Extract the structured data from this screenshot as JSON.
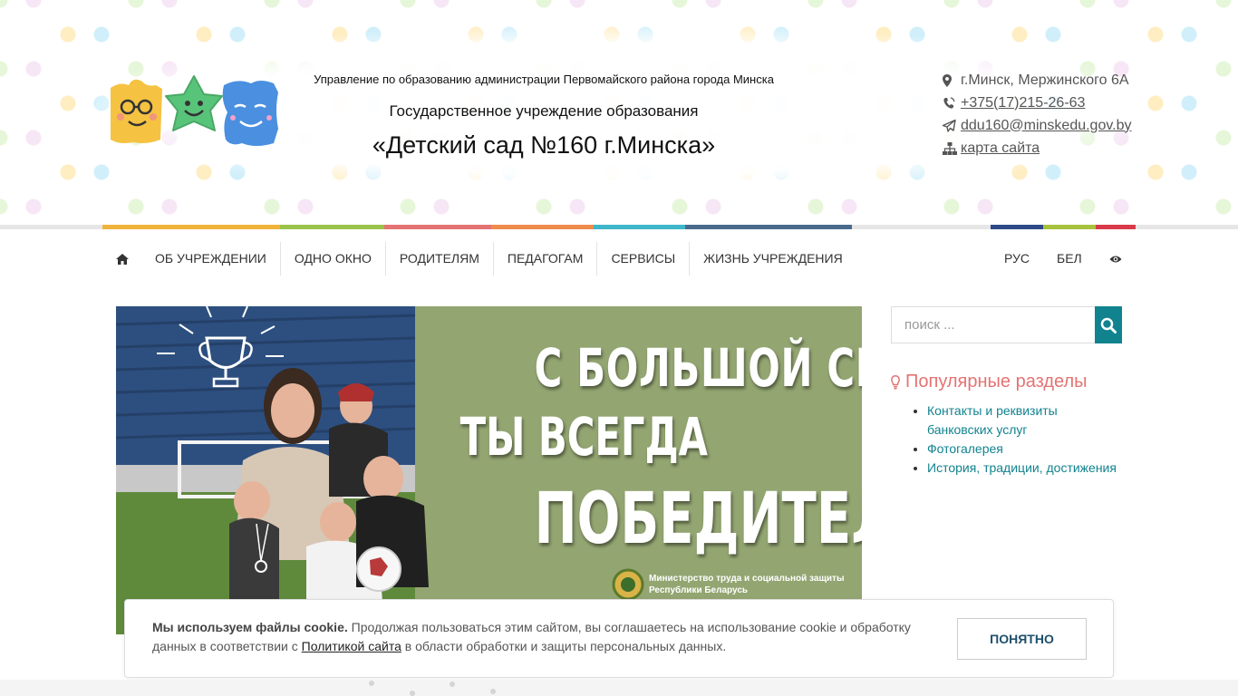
{
  "header": {
    "parent_org": "Управление по образованию администрации Первомайского района города Минска",
    "org_type": "Государственное учреждение образования",
    "org_name": "«Детский сад №160 г.Минска»",
    "contacts": {
      "address": "г.Минск, Мержинского 6А",
      "phone": "+375(17)215-26-63",
      "email": "ddu160@minskedu.gov.by",
      "sitemap": "карта сайта"
    }
  },
  "nav": {
    "items": [
      {
        "label": "ОБ УЧРЕЖДЕНИИ"
      },
      {
        "label": "ОДНО ОКНО"
      },
      {
        "label": "РОДИТЕЛЯМ"
      },
      {
        "label": "ПЕДАГОГАМ"
      },
      {
        "label": "СЕРВИСЫ"
      },
      {
        "label": "ЖИЗНЬ УЧРЕЖДЕНИЯ"
      }
    ],
    "lang_ru": "РУС",
    "lang_by": "БЕЛ"
  },
  "banner": {
    "line1": "С БОЛЬШОЙ СЕМЬЁЙ",
    "line2": "ТЫ ВСЕГДА",
    "line3": "ПОБЕДИТЕЛЬ",
    "ministry_line1": "Министерство труда и социальной защиты",
    "ministry_line2": "Республики Беларусь"
  },
  "sidebar": {
    "search_placeholder": "поиск ...",
    "popular_title": "Популярные разделы",
    "popular_items": [
      "Контакты и реквизиты банковских услуг",
      "Фотогалерея",
      "История, традиции, достижения"
    ]
  },
  "cookie": {
    "bold": "Мы используем файлы cookie.",
    "text_before_link": " Продолжая пользоваться этим сайтом, вы соглашаетесь на использование cookie и обработку данных в соответствии с ",
    "link": "Политикой сайта",
    "text_after_link": " в области обработки и защиты персональных данных.",
    "button": "ПОНЯТНО"
  },
  "colors": {
    "accent_teal": "#11838f",
    "popular_title": "#e57373",
    "strip": [
      "#f0b43a",
      "#9bc34a",
      "#e57373",
      "#ef8c4c",
      "#3fb6c9",
      "#4a6a8c",
      "#2e4a86",
      "#a7c23d",
      "#d83a4a"
    ]
  },
  "icons": {
    "home": "home-icon",
    "eye": "eye-icon",
    "search": "search-icon",
    "lightbulb": "lightbulb-icon",
    "map_marker": "map-marker-icon",
    "phone": "phone-icon",
    "send": "paper-plane-icon",
    "sitemap": "sitemap-icon"
  }
}
